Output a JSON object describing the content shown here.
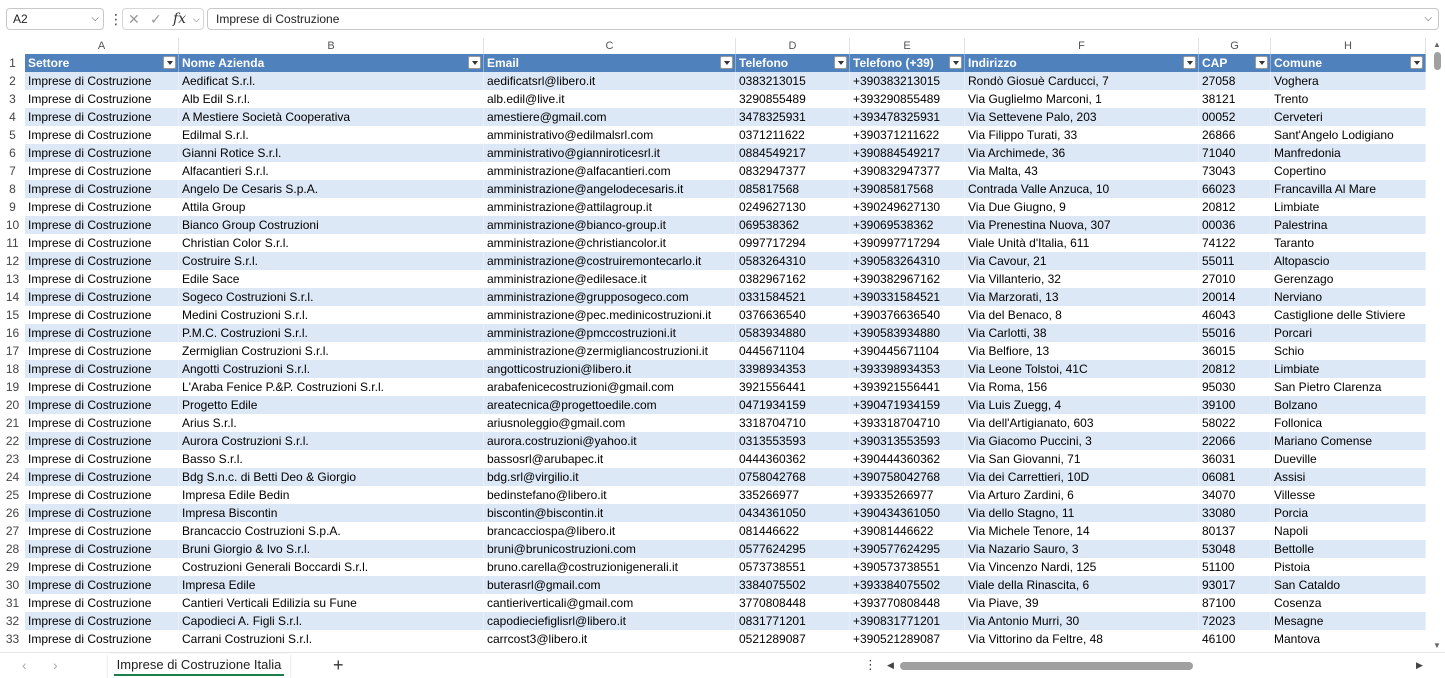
{
  "formula_bar": {
    "name_box": "A2",
    "cancel_icon": "✕",
    "enter_icon": "✓",
    "function_icon": "fx",
    "formula": "Imprese di Costruzione"
  },
  "columns": [
    "A",
    "B",
    "C",
    "D",
    "E",
    "F",
    "G",
    "H"
  ],
  "headers": [
    "Settore",
    "Nome Azienda",
    "Email",
    "Telefono",
    "Telefono (+39)",
    "Indirizzo",
    "CAP",
    "Comune"
  ],
  "rows": [
    [
      "Imprese di Costruzione",
      "Aedificat S.r.l.",
      "aedificatsrl@libero.it",
      "0383213015",
      "+390383213015",
      "Rondò Giosuè Carducci, 7",
      "27058",
      "Voghera"
    ],
    [
      "Imprese di Costruzione",
      "Alb Edil S.r.l.",
      "alb.edil@live.it",
      "3290855489",
      "+393290855489",
      "Via Guglielmo Marconi, 1",
      "38121",
      "Trento"
    ],
    [
      "Imprese di Costruzione",
      "A Mestiere Società Cooperativa",
      "amestiere@gmail.com",
      "3478325931",
      "+393478325931",
      "Via Settevene Palo, 203",
      "00052",
      "Cerveteri"
    ],
    [
      "Imprese di Costruzione",
      "Edilmal S.r.l.",
      "amministrativo@edilmalsrl.com",
      "0371211622",
      "+390371211622",
      "Via Filippo Turati, 33",
      "26866",
      "Sant'Angelo Lodigiano"
    ],
    [
      "Imprese di Costruzione",
      "Gianni Rotice S.r.l.",
      "amministrativo@gianniroticesrl.it",
      "0884549217",
      "+390884549217",
      "Via Archimede, 36",
      "71040",
      "Manfredonia"
    ],
    [
      "Imprese di Costruzione",
      "Alfacantieri S.r.l.",
      "amministrazione@alfacantieri.com",
      "0832947377",
      "+390832947377",
      "Via Malta, 43",
      "73043",
      "Copertino"
    ],
    [
      "Imprese di Costruzione",
      "Angelo De Cesaris S.p.A.",
      "amministrazione@angelodecesaris.it",
      "085817568",
      "+39085817568",
      "Contrada Valle Anzuca, 10",
      "66023",
      "Francavilla Al Mare"
    ],
    [
      "Imprese di Costruzione",
      "Attila Group",
      "amministrazione@attilagroup.it",
      "0249627130",
      "+390249627130",
      "Via Due Giugno, 9",
      "20812",
      "Limbiate"
    ],
    [
      "Imprese di Costruzione",
      "Bianco Group Costruzioni",
      "amministrazione@bianco-group.it",
      "069538362",
      "+39069538362",
      "Via Prenestina Nuova, 307",
      "00036",
      "Palestrina"
    ],
    [
      "Imprese di Costruzione",
      "Christian Color S.r.l.",
      "amministrazione@christiancolor.it",
      "0997717294",
      "+390997717294",
      "Viale Unità d'Italia, 611",
      "74122",
      "Taranto"
    ],
    [
      "Imprese di Costruzione",
      "Costruire S.r.l.",
      "amministrazione@costruiremontecarlo.it",
      "0583264310",
      "+390583264310",
      "Via Cavour, 21",
      "55011",
      "Altopascio"
    ],
    [
      "Imprese di Costruzione",
      "Edile Sace",
      "amministrazione@edilesace.it",
      "0382967162",
      "+390382967162",
      "Via Villanterio, 32",
      "27010",
      "Gerenzago"
    ],
    [
      "Imprese di Costruzione",
      "Sogeco Costruzioni S.r.l.",
      "amministrazione@grupposogeco.com",
      "0331584521",
      "+390331584521",
      "Via Marzorati, 13",
      "20014",
      "Nerviano"
    ],
    [
      "Imprese di Costruzione",
      "Medini Costruzioni S.r.l.",
      "amministrazione@pec.medinicostruzioni.it",
      "0376636540",
      "+390376636540",
      "Via del Benaco, 8",
      "46043",
      "Castiglione delle Stiviere"
    ],
    [
      "Imprese di Costruzione",
      "P.M.C. Costruzioni S.r.l.",
      "amministrazione@pmccostruzioni.it",
      "0583934880",
      "+390583934880",
      "Via Carlotti, 38",
      "55016",
      "Porcari"
    ],
    [
      "Imprese di Costruzione",
      "Zermiglian Costruzioni S.r.l.",
      "amministrazione@zermigliancostruzioni.it",
      "0445671104",
      "+390445671104",
      "Via Belfiore, 13",
      "36015",
      "Schio"
    ],
    [
      "Imprese di Costruzione",
      "Angotti Costruzioni S.r.l.",
      "angotticostruzioni@libero.it",
      "3398934353",
      "+393398934353",
      "Via Leone Tolstoi, 41C",
      "20812",
      "Limbiate"
    ],
    [
      "Imprese di Costruzione",
      "L'Araba Fenice P.&P. Costruzioni S.r.l.",
      "arabafenicecostruzioni@gmail.com",
      "3921556441",
      "+393921556441",
      "Via Roma, 156",
      "95030",
      "San Pietro Clarenza"
    ],
    [
      "Imprese di Costruzione",
      "Progetto Edile",
      "areatecnica@progettoedile.com",
      "0471934159",
      "+390471934159",
      "Via Luis Zuegg, 4",
      "39100",
      "Bolzano"
    ],
    [
      "Imprese di Costruzione",
      "Arius S.r.l.",
      "ariusnoleggio@gmail.com",
      "3318704710",
      "+393318704710",
      "Via dell'Artigianato, 603",
      "58022",
      "Follonica"
    ],
    [
      "Imprese di Costruzione",
      "Aurora Costruzioni S.r.l.",
      "aurora.costruzioni@yahoo.it",
      "0313553593",
      "+390313553593",
      "Via Giacomo Puccini, 3",
      "22066",
      "Mariano Comense"
    ],
    [
      "Imprese di Costruzione",
      "Basso S.r.l.",
      "bassosrl@arubapec.it",
      "0444360362",
      "+390444360362",
      "Via San Giovanni, 71",
      "36031",
      "Dueville"
    ],
    [
      "Imprese di Costruzione",
      "Bdg S.n.c. di Betti Deo & Giorgio",
      "bdg.srl@virgilio.it",
      "0758042768",
      "+390758042768",
      "Via dei Carrettieri, 10D",
      "06081",
      "Assisi"
    ],
    [
      "Imprese di Costruzione",
      "Impresa Edile Bedin",
      "bedinstefano@libero.it",
      "335266977",
      "+39335266977",
      "Via Arturo Zardini, 6",
      "34070",
      "Villesse"
    ],
    [
      "Imprese di Costruzione",
      "Impresa Biscontin",
      "biscontin@biscontin.it",
      "0434361050",
      "+390434361050",
      "Via dello Stagno, 11",
      "33080",
      "Porcia"
    ],
    [
      "Imprese di Costruzione",
      "Brancaccio Costruzioni S.p.A.",
      "brancacciospa@libero.it",
      "081446622",
      "+39081446622",
      "Via Michele Tenore, 14",
      "80137",
      "Napoli"
    ],
    [
      "Imprese di Costruzione",
      "Bruni Giorgio & Ivo S.r.l.",
      "bruni@brunicostruzioni.com",
      "0577624295",
      "+390577624295",
      "Via Nazario Sauro, 3",
      "53048",
      "Bettolle"
    ],
    [
      "Imprese di Costruzione",
      "Costruzioni Generali Boccardi S.r.l.",
      "bruno.carella@costruzionigenerali.it",
      "0573738551",
      "+390573738551",
      "Via Vincenzo Nardi, 125",
      "51100",
      "Pistoia"
    ],
    [
      "Imprese di Costruzione",
      "Impresa Edile",
      "buterasrl@gmail.com",
      "3384075502",
      "+393384075502",
      "Viale della Rinascita, 6",
      "93017",
      "San Cataldo"
    ],
    [
      "Imprese di Costruzione",
      "Cantieri Verticali Edilizia su Fune",
      "cantieriverticali@gmail.com",
      "3770808448",
      "+393770808448",
      "Via Piave, 39",
      "87100",
      "Cosenza"
    ],
    [
      "Imprese di Costruzione",
      "Capodieci A. Figli S.r.l.",
      "capodieciefiglisrl@libero.it",
      "0831771201",
      "+390831771201",
      "Via Antonio Murri, 30",
      "72023",
      "Mesagne"
    ],
    [
      "Imprese di Costruzione",
      "Carrani Costruzioni S.r.l.",
      "carrcost3@libero.it",
      "0521289087",
      "+390521289087",
      "Via Vittorino da Feltre, 48",
      "46100",
      "Mantova"
    ]
  ],
  "sheet_tab": "Imprese di Costruzione Italia",
  "accent": {
    "header_bg": "#4f81bd",
    "band": "#dde8f6",
    "tab_underline": "#1a7f4b"
  }
}
